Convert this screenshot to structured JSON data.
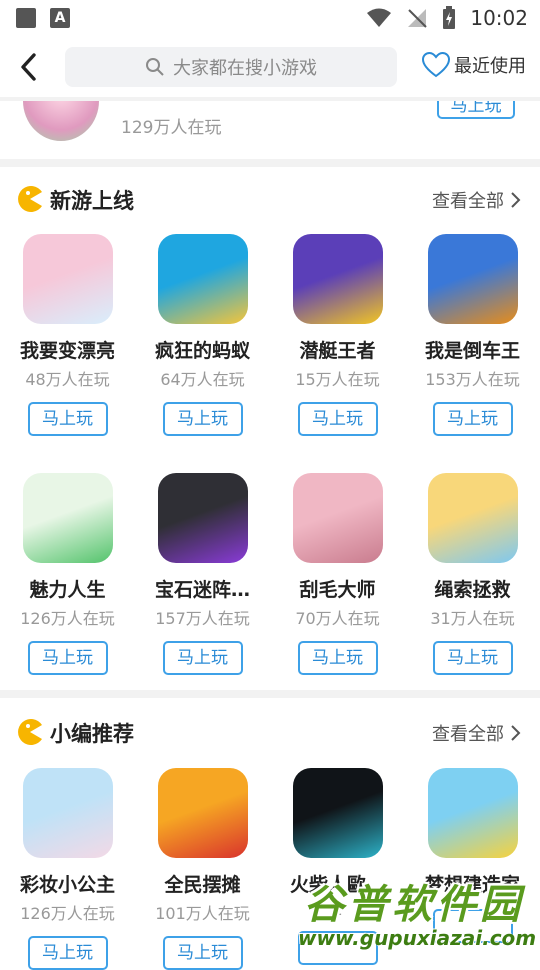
{
  "status_bar": {
    "time": "10:02"
  },
  "header": {
    "search_placeholder": "大家都在搜小游戏",
    "recent_label": "最近使用"
  },
  "partial_item": {
    "count": "129万人在玩",
    "play_label": "马上玩"
  },
  "sections": [
    {
      "title": "新游上线",
      "more_label": "查看全部",
      "games": [
        {
          "name": "我要变漂亮",
          "count": "48万人在玩",
          "play": "马上玩",
          "colors": [
            "#f6c8d9",
            "#d9eefc"
          ]
        },
        {
          "name": "疯狂的蚂蚁",
          "count": "64万人在玩",
          "play": "马上玩",
          "colors": [
            "#1fa6e0",
            "#f5c53a"
          ]
        },
        {
          "name": "潜艇王者",
          "count": "15万人在玩",
          "play": "马上玩",
          "colors": [
            "#5b3fb8",
            "#f3c623"
          ]
        },
        {
          "name": "我是倒车王",
          "count": "153万人在玩",
          "play": "马上玩",
          "colors": [
            "#3a78d8",
            "#e88d1a"
          ]
        },
        {
          "name": "魅力人生",
          "count": "126万人在玩",
          "play": "马上玩",
          "colors": [
            "#e8f6e6",
            "#53c36b"
          ]
        },
        {
          "name": "宝石迷阵…",
          "count": "157万人在玩",
          "play": "马上玩",
          "colors": [
            "#2f2f35",
            "#8a3bd9"
          ]
        },
        {
          "name": "刮毛大师",
          "count": "70万人在玩",
          "play": "马上玩",
          "colors": [
            "#f0b7c4",
            "#c97c8e"
          ]
        },
        {
          "name": "绳索拯救",
          "count": "31万人在玩",
          "play": "马上玩",
          "colors": [
            "#f8d77a",
            "#7ec8f0"
          ]
        }
      ]
    },
    {
      "title": "小编推荐",
      "more_label": "查看全部",
      "games": [
        {
          "name": "彩妆小公主",
          "count": "126万人在玩",
          "play": "马上玩",
          "colors": [
            "#bfe2f7",
            "#f3d9e6"
          ]
        },
        {
          "name": "全民摆摊",
          "count": "101万人在玩",
          "play": "马上玩",
          "colors": [
            "#f6a623",
            "#d9332c"
          ]
        },
        {
          "name": "火柴人歐…",
          "count": "1",
          "play": "",
          "colors": [
            "#101418",
            "#2db3c9"
          ]
        },
        {
          "name": "梦想建造家",
          "count": "",
          "play": "",
          "colors": [
            "#7ed0f2",
            "#f6d23e"
          ]
        }
      ]
    }
  ],
  "watermark": {
    "cn": "谷普软件园",
    "url": "www.gupuxiazai.com"
  },
  "accent_color": "#3ea1e8"
}
